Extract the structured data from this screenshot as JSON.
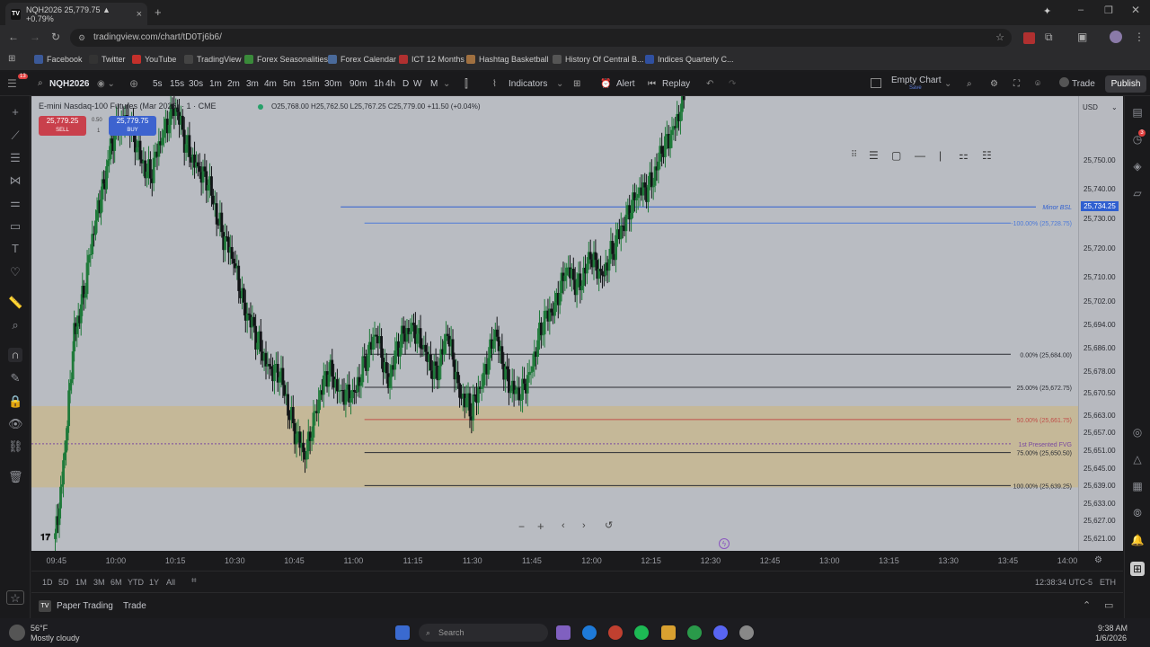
{
  "browser": {
    "tab_title": "NQH2026 25,779.75 ▲ +0.79%",
    "url": "tradingview.com/chart/tD0Tj6b6/",
    "new_tab": "+",
    "bookmarks": [
      {
        "label": "Facebook",
        "color": "#3b5998"
      },
      {
        "label": "Twitter",
        "color": "#333333"
      },
      {
        "label": "YouTube",
        "color": "#c4302b"
      },
      {
        "label": "TradingView",
        "color": "#444444"
      },
      {
        "label": "Forex Seasonalities",
        "color": "#3a8a3a"
      },
      {
        "label": "Forex Calendar",
        "color": "#4a6a9a"
      },
      {
        "label": "ICT 12 Months",
        "color": "#b03030"
      },
      {
        "label": "Hashtag Basketball",
        "color": "#a07040"
      },
      {
        "label": "History Of Central B...",
        "color": "#555555"
      },
      {
        "label": "Indices Quarterly C...",
        "color": "#3050a0"
      }
    ]
  },
  "toolbar": {
    "symbol": "NQH2026",
    "intervals": [
      "5s",
      "15s",
      "30s",
      "1m",
      "2m",
      "3m",
      "4m",
      "5m",
      "15m",
      "30m",
      "90m",
      "1h",
      "4h",
      "D",
      "W",
      "M"
    ],
    "indicators_label": "Indicators",
    "alert_label": "Alert",
    "replay_label": "Replay",
    "layout_name": "Empty Chart",
    "layout_sub": "Save",
    "trade_label": "Trade",
    "publish_label": "Publish",
    "badge_count": "13"
  },
  "legend": {
    "title": "E-mini Nasdaq-100 Futures (Mar 2026) · 1 · CME",
    "ohlc": "O25,768.00 H25,762.50 L25,767.25 C25,779.00 +11.50 (+0.04%)",
    "sell_price": "25,779.25",
    "sell_label": "SELL",
    "buy_price": "25,779.75",
    "buy_label": "BUY",
    "spread": "0.50",
    "spread2": "1"
  },
  "levels": [
    {
      "label": "Minor BSL",
      "price": 25734.25,
      "price_label": "25,734.25",
      "color": "#2f5fd0"
    },
    {
      "label": "-100.00% (25,728.75)",
      "price": 25728.75,
      "color": "#4d7ad8"
    },
    {
      "label": "0.00% (25,684.00)",
      "price": 25684.0,
      "color": "#2b2d33"
    },
    {
      "label": "25.00% (25,672.75)",
      "price": 25672.75,
      "color": "#2b2d33"
    },
    {
      "label": "50.00% (25,661.75)",
      "price": 25661.75,
      "color": "#c0504a"
    },
    {
      "label": "1st Presented FVG",
      "price": 25653.5,
      "color": "#7a4aa0"
    },
    {
      "label": "75.00% (25,650.50)",
      "price": 25650.5,
      "color": "#2b2d33"
    },
    {
      "label": "100.00% (25,639.25)",
      "price": 25639.25,
      "color": "#2b2d33"
    }
  ],
  "chart_data": {
    "type": "candlestick",
    "ylim": [
      25617,
      25772
    ],
    "y_ticks": [
      25750.0,
      25740.0,
      25730.0,
      25720.0,
      25710.0,
      25702.0,
      25694.0,
      25686.0,
      25678.0,
      25670.5,
      25663.0,
      25657.0,
      25651.0,
      25645.0,
      25639.0,
      25633.0,
      25627.0,
      25621.0
    ],
    "y_tick_labels": [
      "25,750.00",
      "25,740.00",
      "25,730.00",
      "25,720.00",
      "25,710.00",
      "25,702.00",
      "25,694.00",
      "25,686.00",
      "25,678.00",
      "25,670.50",
      "25,663.00",
      "25,657.00",
      "25,651.00",
      "25,645.00",
      "25,639.00",
      "25,633.00",
      "25,627.00",
      "25,621.00"
    ],
    "x_tick_labels": [
      "09:45",
      "10:00",
      "10:15",
      "10:30",
      "10:45",
      "11:00",
      "11:15",
      "11:30",
      "11:45",
      "12:00",
      "12:15",
      "12:30",
      "12:45",
      "13:00",
      "13:15",
      "13:30",
      "13:45",
      "14:00"
    ],
    "currency": "USD",
    "close_path": [
      [
        9.75,
        25621
      ],
      [
        9.79,
        25650
      ],
      [
        9.83,
        25690
      ],
      [
        9.87,
        25705
      ],
      [
        9.92,
        25730
      ],
      [
        9.96,
        25745
      ],
      [
        10.0,
        25760
      ],
      [
        10.05,
        25765
      ],
      [
        10.1,
        25752
      ],
      [
        10.15,
        25745
      ],
      [
        10.2,
        25758
      ],
      [
        10.25,
        25770
      ],
      [
        10.3,
        25755
      ],
      [
        10.35,
        25748
      ],
      [
        10.4,
        25740
      ],
      [
        10.45,
        25726
      ],
      [
        10.5,
        25715
      ],
      [
        10.55,
        25700
      ],
      [
        10.6,
        25688
      ],
      [
        10.65,
        25680
      ],
      [
        10.7,
        25675
      ],
      [
        10.75,
        25660
      ],
      [
        10.8,
        25648
      ],
      [
        10.85,
        25668
      ],
      [
        10.9,
        25678
      ],
      [
        10.95,
        25672
      ],
      [
        11.0,
        25668
      ],
      [
        11.05,
        25682
      ],
      [
        11.1,
        25690
      ],
      [
        11.15,
        25676
      ],
      [
        11.2,
        25688
      ],
      [
        11.25,
        25695
      ],
      [
        11.3,
        25684
      ],
      [
        11.35,
        25678
      ],
      [
        11.4,
        25690
      ],
      [
        11.45,
        25672
      ],
      [
        11.5,
        25664
      ],
      [
        11.55,
        25678
      ],
      [
        11.6,
        25690
      ],
      [
        11.65,
        25676
      ],
      [
        11.7,
        25668
      ],
      [
        11.75,
        25680
      ],
      [
        11.8,
        25694
      ],
      [
        11.85,
        25702
      ],
      [
        11.9,
        25712
      ],
      [
        11.95,
        25708
      ],
      [
        12.0,
        25716
      ],
      [
        12.05,
        25712
      ],
      [
        12.1,
        25720
      ],
      [
        12.15,
        25732
      ],
      [
        12.2,
        25738
      ],
      [
        12.25,
        25742
      ],
      [
        12.3,
        25752
      ],
      [
        12.35,
        25762
      ],
      [
        12.4,
        25772
      ]
    ]
  },
  "time_axis": {
    "clock": "12:38:34 UTC-5",
    "session": "ETH"
  },
  "ranges": [
    "1D",
    "5D",
    "1M",
    "3M",
    "6M",
    "YTD",
    "1Y",
    "All"
  ],
  "bottom_panel": {
    "tab1": "Paper Trading",
    "tab2": "Trade"
  },
  "taskbar": {
    "weather_temp": "56°F",
    "weather_desc": "Mostly cloudy",
    "search": "Search",
    "time": "9:38 AM",
    "date": "1/6/2026"
  }
}
